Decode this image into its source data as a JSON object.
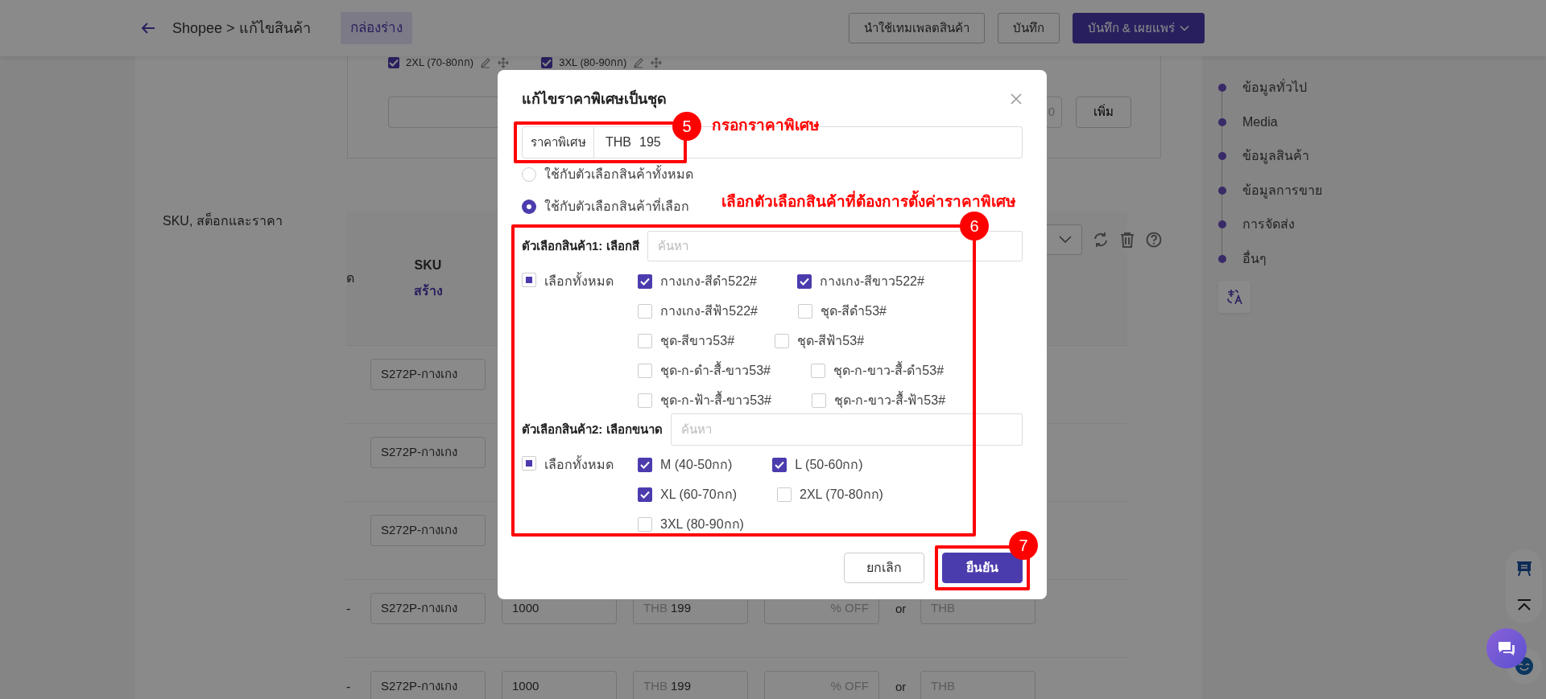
{
  "header": {
    "breadcrumb": "Shopee > แก้ไขสินค้า",
    "status": "กล่องร่าง",
    "buttons": [
      {
        "label": "นำใช้เทมเพลตสินค้า",
        "kind": "outline"
      },
      {
        "label": "บันทึก",
        "kind": "outline"
      },
      {
        "label": "บันทึก & เผยแพร่",
        "kind": "primary-dropdown"
      }
    ]
  },
  "variant_editor": {
    "options": [
      {
        "label": "2XL (70-80กก)",
        "checked": true
      },
      {
        "label": "3XL (80-90กก)",
        "checked": true
      }
    ],
    "counter": "0",
    "add_button": "เพิ่ม"
  },
  "sku_section": {
    "title": "SKU, สต็อกและราคา",
    "columns": [
      {
        "label": "ด"
      },
      {
        "label": "SKU",
        "action": "สร้าง"
      }
    ],
    "rows": [
      {
        "sku": "S272P-กางเกง"
      },
      {
        "sku": "S272P-กางเกง"
      },
      {
        "sku": "S272P-กางเกง"
      },
      {
        "variation": "-",
        "sku": "S272P-กางเกง",
        "stock": "1000",
        "price": {
          "currency": "THB",
          "value": "199"
        },
        "discount_placeholder": "% OFF",
        "separator": "or",
        "final_price_placeholder": "THB"
      },
      {
        "variation": "-",
        "sku": "S272P-กางเกง",
        "stock": "1000",
        "price": {
          "currency": "THB",
          "value": "199"
        },
        "discount_placeholder": "% OFF",
        "separator": "or",
        "final_price_placeholder": "THB"
      }
    ]
  },
  "section_nav": {
    "items": [
      "ข้อมูลทั่วไป",
      "Media",
      "ข้อมูลสินค้า",
      "ข้อมูลการขาย",
      "การจัดส่ง",
      "อื่นๆ"
    ]
  },
  "dialog": {
    "title": "แก้ไขราคาพิเศษเป็นชุด",
    "price": {
      "label": "ราคาพิเศษ",
      "currency": "THB",
      "value": "195"
    },
    "scope_options": [
      {
        "label": "ใช้กับตัวเลือกสินค้าทั้งหมด",
        "selected": false
      },
      {
        "label": "ใช้กับตัวเลือกสินค้าที่เลือก",
        "selected": true
      }
    ],
    "variations": [
      {
        "label": "ตัวเลือกสินค้า1: เลือกสี",
        "search_placeholder": "ค้นหา",
        "select_all": {
          "label": "เลือกทั้งหมด",
          "indeterminate": true
        },
        "options": [
          {
            "label": "กางเกง-สีดำ522#",
            "checked": true
          },
          {
            "label": "กางเกง-สีขาว522#",
            "checked": true
          },
          {
            "label": "กางเกง-สีฟ้า522#",
            "checked": false
          },
          {
            "label": "ชุด-สีดำ53#",
            "checked": false
          },
          {
            "label": "ชุด-สีขาว53#",
            "checked": false
          },
          {
            "label": "ชุด-สีฟ้า53#",
            "checked": false
          },
          {
            "label": "ชุด-ก-ดำ-สื้-ขาว53#",
            "checked": false
          },
          {
            "label": "ชุด-ก-ขาว-สื้-ดำ53#",
            "checked": false
          },
          {
            "label": "ชุด-ก-ฟ้า-สื้-ขาว53#",
            "checked": false
          },
          {
            "label": "ชุด-ก-ขาว-สื้-ฟ้า53#",
            "checked": false
          }
        ]
      },
      {
        "label": "ตัวเลือกสินค้า2: เลือกขนาด",
        "search_placeholder": "ค้นหา",
        "select_all": {
          "label": "เลือกทั้งหมด",
          "indeterminate": true
        },
        "options": [
          {
            "label": "M (40-50กก)",
            "checked": true
          },
          {
            "label": "L (50-60กก)",
            "checked": true
          },
          {
            "label": "XL (60-70กก)",
            "checked": true
          },
          {
            "label": "2XL (70-80กก)",
            "checked": false
          },
          {
            "label": "3XL (80-90กก)",
            "checked": false
          }
        ]
      }
    ],
    "buttons": [
      {
        "label": "ยกเลิก",
        "kind": "secondary"
      },
      {
        "label": "ยืนยัน",
        "kind": "primary"
      }
    ]
  },
  "annotations": [
    {
      "number": "5",
      "text": "กรอกราคาพิเศษ"
    },
    {
      "number": "6",
      "text": "เลือกตัวเลือกสินค้าที่ต้องการตั้งค่าราคาพิเศษ"
    },
    {
      "number": "7"
    }
  ]
}
